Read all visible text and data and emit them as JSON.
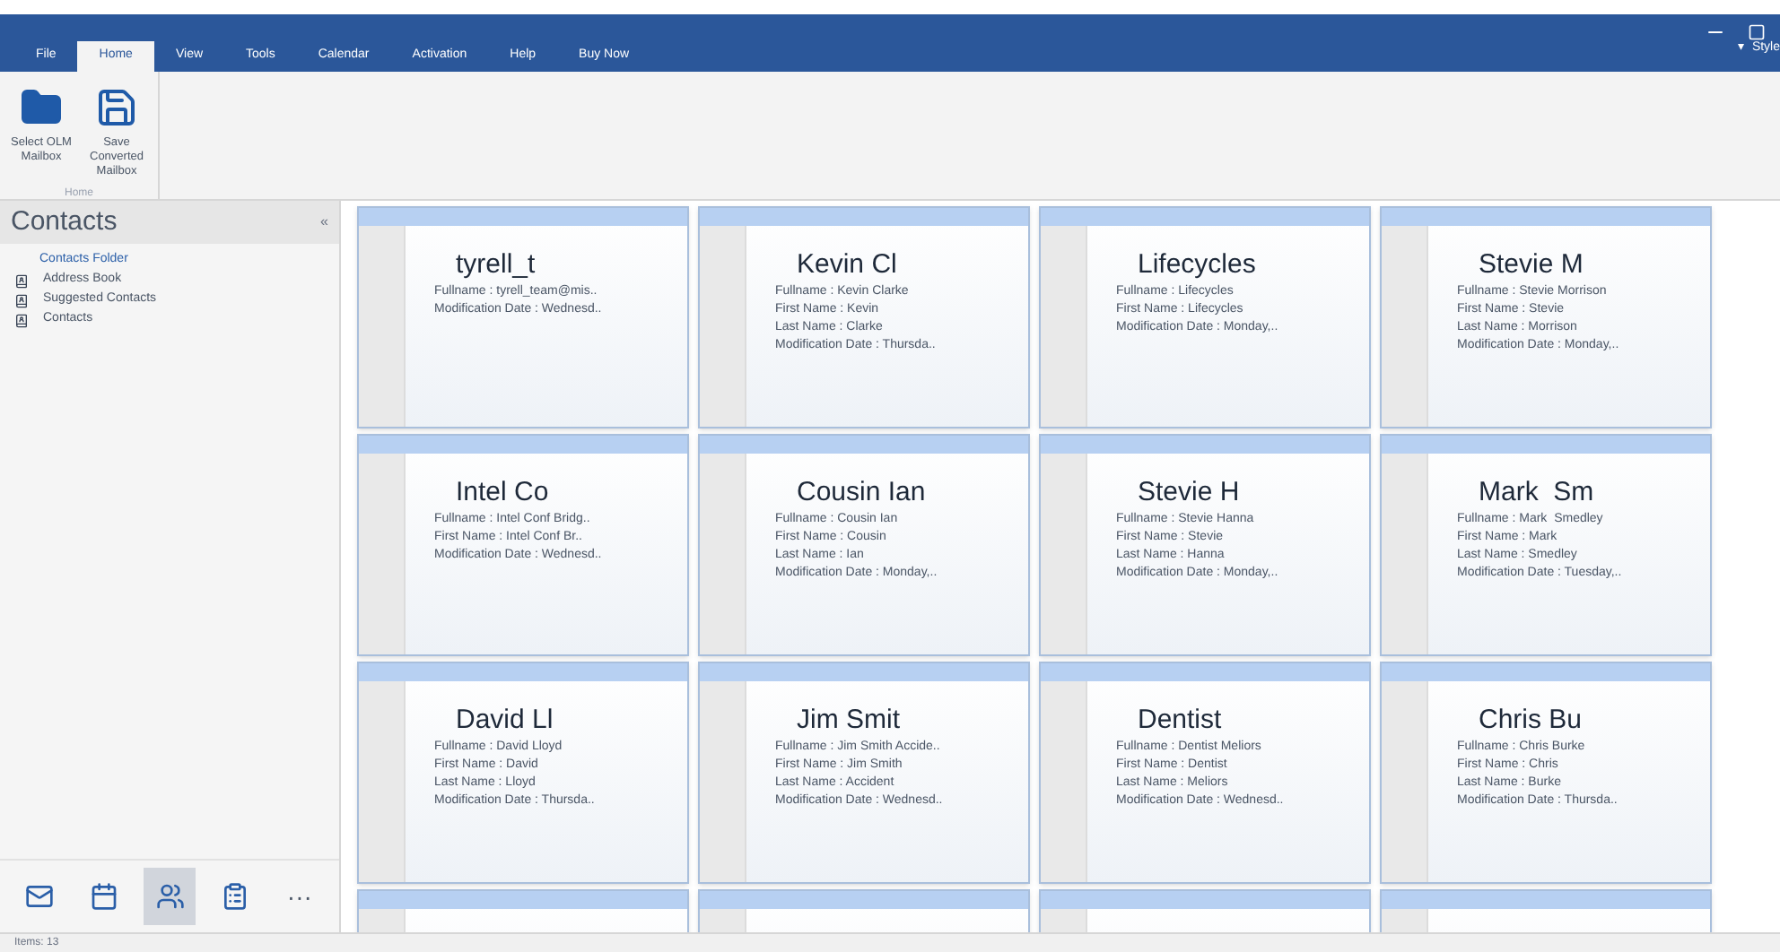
{
  "menu_tabs": [
    {
      "label": "File",
      "selected": false
    },
    {
      "label": "Home",
      "selected": true
    },
    {
      "label": "View",
      "selected": false
    },
    {
      "label": "Tools",
      "selected": false
    },
    {
      "label": "Calendar",
      "selected": false
    },
    {
      "label": "Activation",
      "selected": false
    },
    {
      "label": "Help",
      "selected": false
    },
    {
      "label": "Buy Now",
      "selected": false
    }
  ],
  "style_menu": {
    "caret": "▾",
    "label": "Style"
  },
  "ribbon": {
    "buttons": [
      {
        "kind": "folder",
        "label": "Select OLM Mailbox"
      },
      {
        "kind": "save",
        "label": "Save Converted Mailbox"
      }
    ],
    "group_label": "Home"
  },
  "sidebar": {
    "title": "Contacts",
    "collapse": "«",
    "items": [
      {
        "kind": "folder",
        "label": "Contacts Folder",
        "selected": true
      },
      {
        "kind": "book",
        "label": "Address Book",
        "selected": false
      },
      {
        "kind": "book",
        "label": "Suggested Contacts",
        "selected": false
      },
      {
        "kind": "book",
        "label": "Contacts",
        "selected": false
      }
    ],
    "nav": [
      {
        "kind": "mail",
        "selected": false
      },
      {
        "kind": "calendar",
        "selected": false
      },
      {
        "kind": "people",
        "selected": true
      },
      {
        "kind": "tasks",
        "selected": false
      },
      {
        "kind": "more",
        "label": "···",
        "selected": false
      }
    ]
  },
  "cards": [
    {
      "name": "tyrell_t",
      "lines": [
        "Fullname : tyrell_team@mis..",
        "Modification Date : Wednesd.."
      ]
    },
    {
      "name": "Kevin Cl",
      "lines": [
        "Fullname : Kevin Clarke",
        "First Name : Kevin",
        "Last Name : Clarke",
        "Modification Date : Thursda.."
      ]
    },
    {
      "name": "Lifecycles",
      "lines": [
        "Fullname : Lifecycles",
        "First Name : Lifecycles",
        "Modification Date : Monday,.."
      ]
    },
    {
      "name": "Stevie M",
      "lines": [
        "Fullname : Stevie Morrison",
        "First Name : Stevie",
        "Last Name : Morrison",
        "Modification Date : Monday,.."
      ]
    },
    {
      "name": "Intel Co",
      "lines": [
        "Fullname : Intel Conf Bridg..",
        "First Name : Intel Conf Br..",
        "Modification Date : Wednesd.."
      ]
    },
    {
      "name": "Cousin Ian",
      "lines": [
        "Fullname : Cousin Ian",
        "First Name : Cousin",
        "Last Name : Ian",
        "Modification Date : Monday,.."
      ]
    },
    {
      "name": "Stevie H",
      "lines": [
        "Fullname : Stevie Hanna",
        "First Name : Stevie",
        "Last Name : Hanna",
        "Modification Date : Monday,.."
      ]
    },
    {
      "name": "Mark  Sm",
      "lines": [
        "Fullname : Mark  Smedley",
        "First Name : Mark",
        "Last Name : Smedley",
        "Modification Date : Tuesday,.."
      ]
    },
    {
      "name": "David Ll",
      "lines": [
        "Fullname : David Lloyd",
        "First Name : David",
        "Last Name : Lloyd",
        "Modification Date : Thursda.."
      ]
    },
    {
      "name": "Jim Smit",
      "lines": [
        "Fullname : Jim Smith Accide..",
        "First Name : Jim Smith",
        "Last Name : Accident",
        "Modification Date : Wednesd.."
      ]
    },
    {
      "name": "Dentist",
      "lines": [
        "Fullname : Dentist Meliors",
        "First Name : Dentist",
        "Last Name : Meliors",
        "Modification Date : Wednesd.."
      ]
    },
    {
      "name": "Chris Bu",
      "lines": [
        "Fullname : Chris Burke",
        "First Name : Chris",
        "Last Name : Burke",
        "Modification Date : Thursda.."
      ]
    }
  ],
  "status_bar": {
    "text": "Items: 13"
  }
}
